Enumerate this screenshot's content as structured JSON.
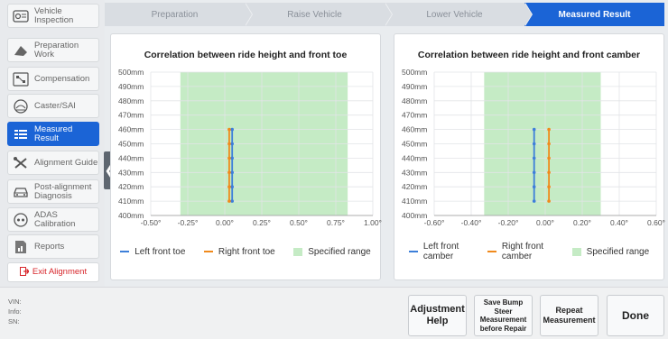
{
  "sidebar": {
    "items": [
      {
        "label": "Vehicle Inspection",
        "icon": "vehicle-inspection-icon",
        "active": false
      },
      {
        "label": "Preparation Work",
        "icon": "preparation-icon",
        "active": false
      },
      {
        "label": "Compensation",
        "icon": "compensation-icon",
        "active": false
      },
      {
        "label": "Caster/SAI",
        "icon": "caster-icon",
        "active": false
      },
      {
        "label": "Measured Result",
        "icon": "measured-result-icon",
        "active": true
      },
      {
        "label": "Alignment Guide",
        "icon": "wrench-icon",
        "active": false
      },
      {
        "label": "Post-alignment Diagnosis",
        "icon": "car-icon",
        "active": false
      },
      {
        "label": "ADAS Calibration",
        "icon": "adas-icon",
        "active": false
      },
      {
        "label": "Reports",
        "icon": "report-icon",
        "active": false
      }
    ],
    "exit_label": "Exit Alignment"
  },
  "steps": [
    {
      "label": "Preparation",
      "active": false
    },
    {
      "label": "Raise Vehicle",
      "active": false
    },
    {
      "label": "Lower Vehicle",
      "active": false
    },
    {
      "label": "Measured Result",
      "active": true
    }
  ],
  "colors": {
    "accent": "#1b64d6",
    "left_series": "#3d7fd9",
    "right_series": "#f08a1c",
    "range_fill": "#c5ebc5",
    "exit_red": "#d7262b"
  },
  "chart_data": [
    {
      "type": "line",
      "title": "Correlation between ride height and front toe",
      "x_ticks": [
        "-0.50°",
        "-0.25°",
        "0.00°",
        "0.25°",
        "0.50°",
        "0.75°",
        "1.00°"
      ],
      "y_ticks": [
        "400mm",
        "410mm",
        "420mm",
        "430mm",
        "440mm",
        "450mm",
        "460mm",
        "470mm",
        "480mm",
        "490mm",
        "500mm"
      ],
      "xlim": [
        -0.5,
        1.0
      ],
      "ylim": [
        400,
        500
      ],
      "grid": true,
      "legend_position": "bottom",
      "specified_range": {
        "name": "Specified range",
        "x": [
          -0.3,
          0.83
        ]
      },
      "series": [
        {
          "name": "Left front toe",
          "x": [
            0.05,
            0.05,
            0.05,
            0.05,
            0.05,
            0.05
          ],
          "y": [
            410,
            420,
            430,
            440,
            450,
            460
          ]
        },
        {
          "name": "Right front toe",
          "x": [
            0.03,
            0.03,
            0.03,
            0.03,
            0.03,
            0.03
          ],
          "y": [
            410,
            420,
            430,
            440,
            450,
            460
          ]
        }
      ]
    },
    {
      "type": "line",
      "title": "Correlation between ride height and front camber",
      "x_ticks": [
        "-0.60°",
        "-0.40°",
        "-0.20°",
        "0.00°",
        "0.20°",
        "0.40°",
        "0.60°"
      ],
      "y_ticks": [
        "400mm",
        "410mm",
        "420mm",
        "430mm",
        "440mm",
        "450mm",
        "460mm",
        "470mm",
        "480mm",
        "490mm",
        "500mm"
      ],
      "xlim": [
        -0.6,
        0.6
      ],
      "ylim": [
        400,
        500
      ],
      "grid": true,
      "legend_position": "bottom",
      "specified_range": {
        "name": "Specified range",
        "x": [
          -0.33,
          0.3
        ]
      },
      "series": [
        {
          "name": "Left front camber",
          "x": [
            -0.06,
            -0.06,
            -0.06,
            -0.06,
            -0.06,
            -0.06
          ],
          "y": [
            410,
            420,
            430,
            440,
            450,
            460
          ]
        },
        {
          "name": "Right front camber",
          "x": [
            0.02,
            0.02,
            0.02,
            0.02,
            0.02,
            0.02
          ],
          "y": [
            410,
            420,
            430,
            440,
            450,
            460
          ]
        }
      ]
    }
  ],
  "legends": [
    {
      "left": "Left front toe",
      "right": "Right front toe",
      "range": "Specified range"
    },
    {
      "left_line1": "Left front",
      "left_line2": "camber",
      "right_line1": "Right front",
      "right_line2": "camber",
      "range": "Specified range"
    }
  ],
  "bottom": {
    "vin_label": "VIN:",
    "info_label": "Info:",
    "sn_label": "SN:",
    "buttons": {
      "adjustment_help": "Adjustment Help",
      "save_bump": "Save Bump Steer Measurement before Repair",
      "repeat": "Repeat Measurement",
      "done": "Done"
    }
  }
}
